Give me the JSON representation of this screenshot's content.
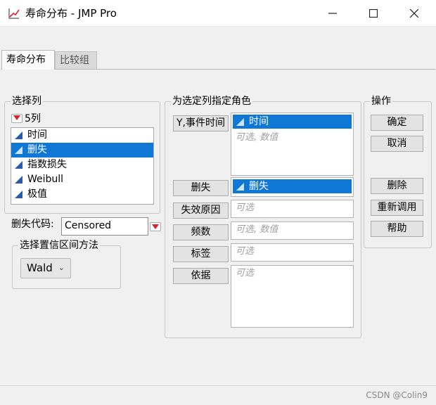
{
  "window": {
    "title": "寿命分布 - JMP Pro",
    "icon": "chart-line-icon"
  },
  "tabs": [
    {
      "label": "寿命分布",
      "active": true
    },
    {
      "label": "比较组",
      "active": false
    }
  ],
  "select_columns": {
    "title": "选择列",
    "count_label": "5列",
    "items": [
      {
        "label": "时间",
        "selected": false
      },
      {
        "label": "删失",
        "selected": true
      },
      {
        "label": "指数损失",
        "selected": false
      },
      {
        "label": "Weibull",
        "selected": false
      },
      {
        "label": "极值",
        "selected": false
      }
    ]
  },
  "censor_code": {
    "label": "删失代码:",
    "value": "Censored"
  },
  "ci_method": {
    "title": "选择置信区间方法",
    "value": "Wald"
  },
  "roles": {
    "title": "为选定列指定角色",
    "y_time": {
      "button": "Y,事件时间",
      "value": "时间",
      "placeholder": "可选, 数值"
    },
    "censor": {
      "button": "删失",
      "value": "删失"
    },
    "failure_cause": {
      "button": "失效原因",
      "placeholder": "可选"
    },
    "freq": {
      "button": "频数",
      "placeholder": "可选, 数值"
    },
    "label": {
      "button": "标签",
      "placeholder": "可选"
    },
    "by": {
      "button": "依据",
      "placeholder": "可选"
    }
  },
  "actions": {
    "title": "操作",
    "ok": "确定",
    "cancel": "取消",
    "remove": "删除",
    "recall": "重新调用",
    "help": "帮助"
  },
  "footer": {
    "watermark": "CSDN @Colin9"
  },
  "colors": {
    "selection": "#0f78d7",
    "dropdown_red": "#d9232d",
    "accent_icon": "#2a5ba8"
  }
}
